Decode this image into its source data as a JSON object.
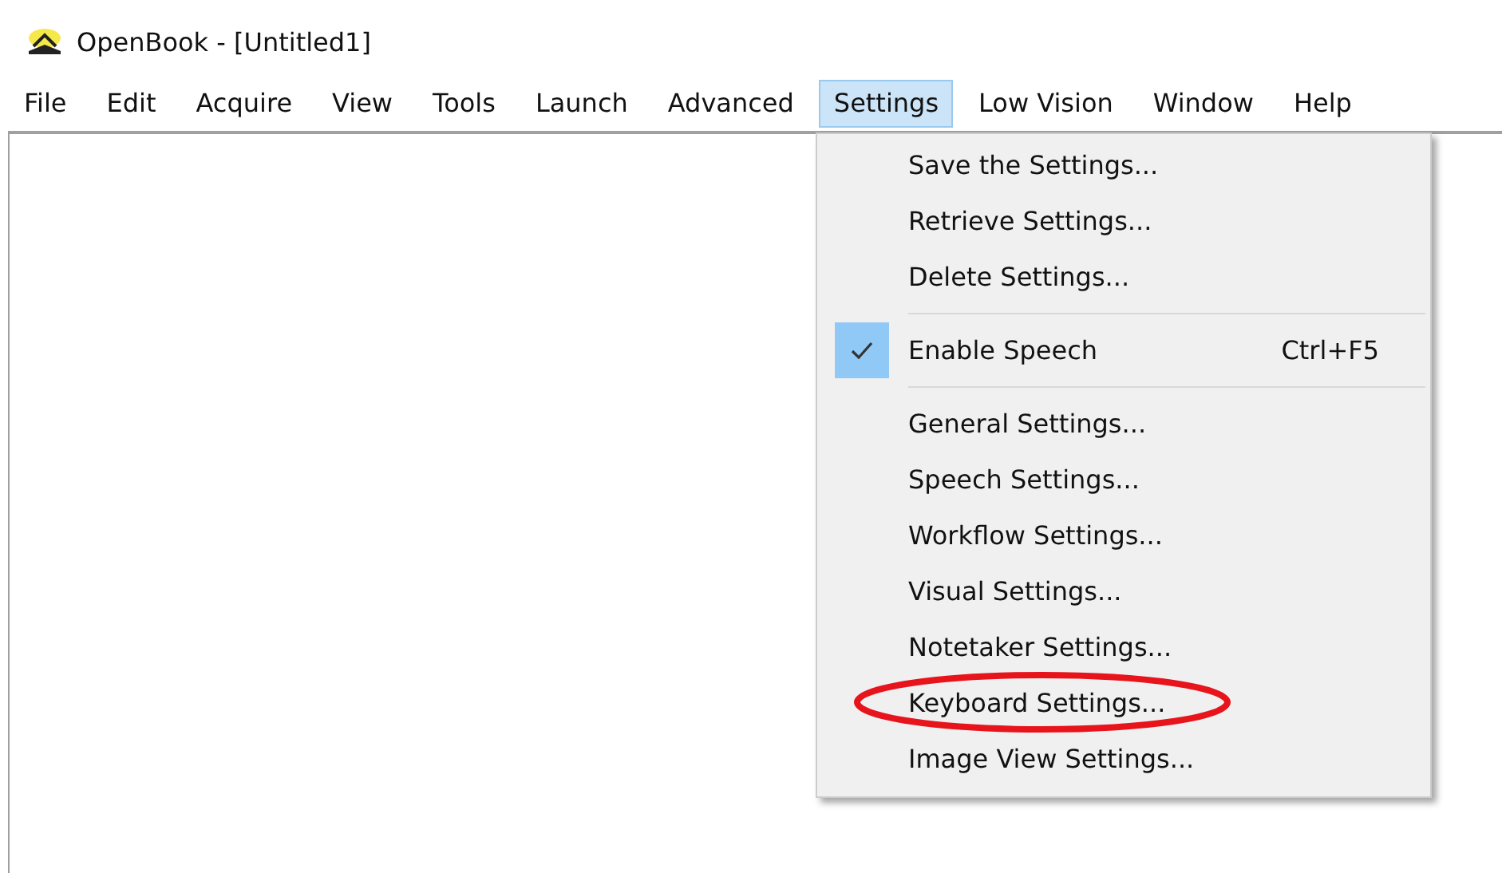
{
  "window": {
    "title": "OpenBook - [Untitled1]"
  },
  "menu_bar": [
    {
      "label": "File",
      "selected": false
    },
    {
      "label": "Edit",
      "selected": false
    },
    {
      "label": "Acquire",
      "selected": false
    },
    {
      "label": "View",
      "selected": false
    },
    {
      "label": "Tools",
      "selected": false
    },
    {
      "label": "Launch",
      "selected": false
    },
    {
      "label": "Advanced",
      "selected": false
    },
    {
      "label": "Settings",
      "selected": true
    },
    {
      "label": "Low Vision",
      "selected": false
    },
    {
      "label": "Window",
      "selected": false
    },
    {
      "label": "Help",
      "selected": false
    }
  ],
  "settings_menu": [
    {
      "kind": "item",
      "label": "Save the Settings...",
      "checked": false,
      "circled": false
    },
    {
      "kind": "item",
      "label": "Retrieve Settings...",
      "checked": false,
      "circled": false
    },
    {
      "kind": "item",
      "label": "Delete Settings...",
      "checked": false,
      "circled": false
    },
    {
      "kind": "separator"
    },
    {
      "kind": "item",
      "label": "Enable Speech",
      "shortcut": "Ctrl+F5",
      "checked": true,
      "circled": false
    },
    {
      "kind": "separator"
    },
    {
      "kind": "item",
      "label": "General Settings...",
      "checked": false,
      "circled": false
    },
    {
      "kind": "item",
      "label": "Speech Settings...",
      "checked": false,
      "circled": false
    },
    {
      "kind": "item",
      "label": "Workflow Settings...",
      "checked": false,
      "circled": false
    },
    {
      "kind": "item",
      "label": "Visual Settings...",
      "checked": false,
      "circled": false
    },
    {
      "kind": "item",
      "label": "Notetaker Settings...",
      "checked": false,
      "circled": false
    },
    {
      "kind": "item",
      "label": "Keyboard Settings...",
      "checked": false,
      "circled": true
    },
    {
      "kind": "item",
      "label": "Image View Settings...",
      "checked": false,
      "circled": false
    }
  ]
}
